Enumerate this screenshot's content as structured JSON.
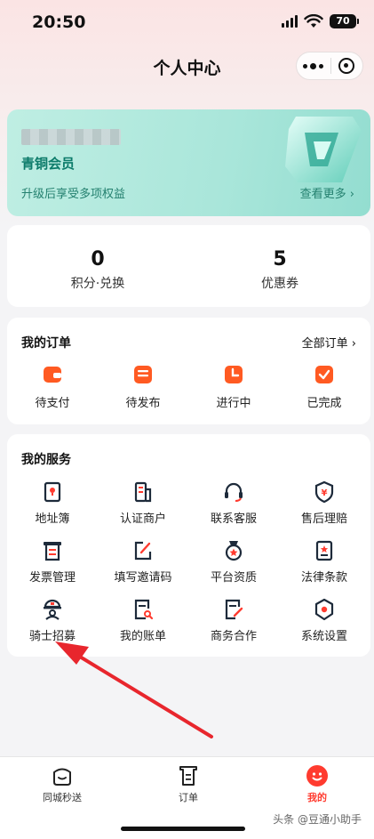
{
  "status_bar": {
    "time": "20:50",
    "battery": "70"
  },
  "nav": {
    "title": "个人中心"
  },
  "member": {
    "level": "青铜会员",
    "benefit_text": "升级后享受多项权益",
    "see_more": "查看更多 ›"
  },
  "stats": [
    {
      "value": "0",
      "label": "积分·兑换"
    },
    {
      "value": "5",
      "label": "优惠券"
    }
  ],
  "orders": {
    "title": "我的订单",
    "all_label": "全部订单 ›",
    "items": [
      {
        "label": "待支付",
        "icon": "wallet-icon"
      },
      {
        "label": "待发布",
        "icon": "list-icon"
      },
      {
        "label": "进行中",
        "icon": "clock-icon"
      },
      {
        "label": "已完成",
        "icon": "check-icon"
      }
    ]
  },
  "services": {
    "title": "我的服务",
    "items": [
      {
        "label": "地址簿",
        "icon": "address-book-icon"
      },
      {
        "label": "认证商户",
        "icon": "merchant-icon"
      },
      {
        "label": "联系客服",
        "icon": "headset-icon"
      },
      {
        "label": "售后理赔",
        "icon": "shield-yen-icon"
      },
      {
        "label": "发票管理",
        "icon": "invoice-icon"
      },
      {
        "label": "填写邀请码",
        "icon": "edit-icon"
      },
      {
        "label": "平台资质",
        "icon": "medal-icon"
      },
      {
        "label": "法律条款",
        "icon": "law-doc-icon"
      },
      {
        "label": "骑士招募",
        "icon": "rider-icon"
      },
      {
        "label": "我的账单",
        "icon": "bill-search-icon"
      },
      {
        "label": "商务合作",
        "icon": "doc-edit-icon"
      },
      {
        "label": "系统设置",
        "icon": "settings-icon"
      }
    ]
  },
  "tabs": [
    {
      "label": "同城秒送",
      "icon": "home-bag-icon",
      "active": false
    },
    {
      "label": "订单",
      "icon": "order-icon",
      "active": false
    },
    {
      "label": "我的",
      "icon": "profile-icon",
      "active": true
    }
  ],
  "watermark": "头条 @豆通小助手",
  "colors": {
    "accent": "#ff3b2f",
    "member_green": "#0c7b6a",
    "arrow": "#e8262d"
  }
}
